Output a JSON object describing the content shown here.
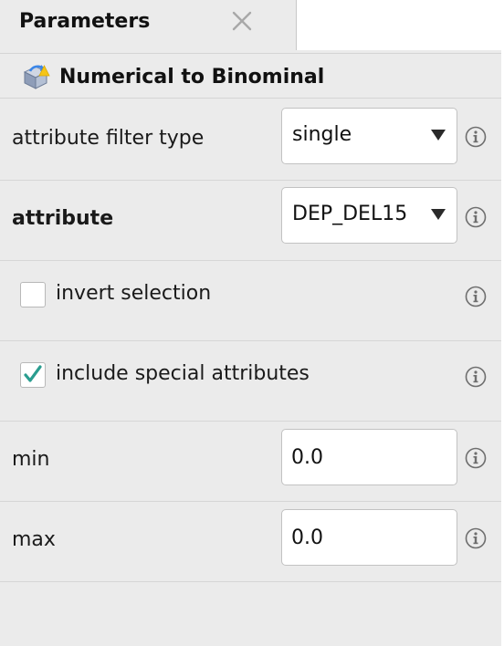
{
  "tab": {
    "title": "Parameters"
  },
  "operator": {
    "title": "Numerical to Binominal",
    "icon": "operator-icon"
  },
  "params": {
    "attribute_filter_type": {
      "label": "attribute filter type",
      "value": "single"
    },
    "attribute": {
      "label": "attribute",
      "value": "DEP_DEL15"
    },
    "invert_selection": {
      "label": "invert selection",
      "checked": false
    },
    "include_special_attributes": {
      "label": "include special attributes",
      "checked": true
    },
    "min": {
      "label": "min",
      "value": "0.0"
    },
    "max": {
      "label": "max",
      "value": "0.0"
    }
  },
  "colors": {
    "background": "#ebebeb",
    "check": "#2a9d8f",
    "info_icon": "#6e6e6e"
  }
}
